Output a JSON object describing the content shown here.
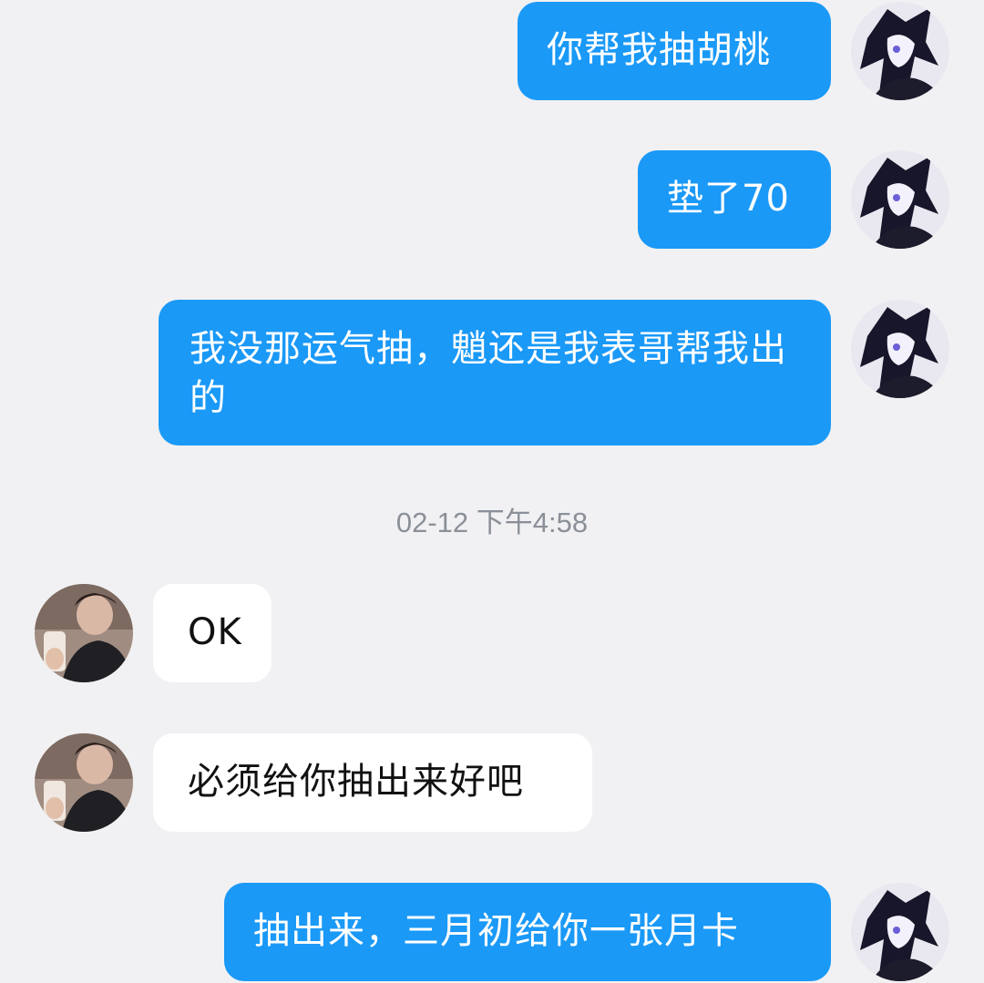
{
  "messages": [
    {
      "side": "out",
      "text": "你帮我抽胡桃"
    },
    {
      "side": "out",
      "text": "垫了70"
    },
    {
      "side": "out",
      "text": "我没那运气抽，魈还是我表哥帮我出的"
    },
    {
      "side": "in",
      "text": "OK"
    },
    {
      "side": "in",
      "text": "必须给你抽出来好吧"
    },
    {
      "side": "out",
      "text": "抽出来，三月初给你一张月卡"
    }
  ],
  "timestamp": "02-12 下午4:58",
  "colors": {
    "background": "#f1f1f3",
    "outgoing_bubble": "#1a99f7",
    "incoming_bubble": "#ffffff",
    "timestamp_text": "#8b8f98"
  },
  "icons": {
    "self_avatar": "anime-character-avatar",
    "contact_avatar": "person-photo-avatar"
  }
}
